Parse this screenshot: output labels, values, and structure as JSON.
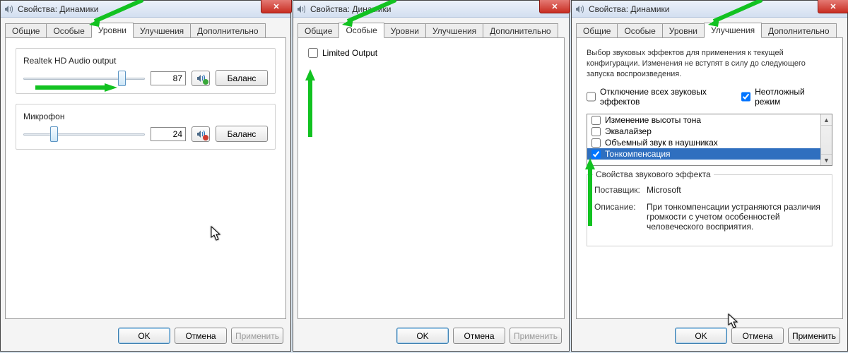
{
  "common": {
    "window_title": "Свойства: Динамики",
    "tabs": {
      "general": "Общие",
      "custom": "Особые",
      "levels": "Уровни",
      "enhance": "Улучшения",
      "advanced": "Дополнительно"
    },
    "btn": {
      "ok": "OK",
      "cancel": "Отмена",
      "apply": "Применить",
      "balance": "Баланс"
    }
  },
  "w1": {
    "dev1": {
      "label": "Realtek HD Audio output",
      "value": "87",
      "thumb_pct": 78
    },
    "dev2": {
      "label": "Микрофон",
      "value": "24",
      "thumb_pct": 22
    }
  },
  "w2": {
    "opt": "Limited Output"
  },
  "w3": {
    "desc": "Выбор звуковых эффектов для применения к текущей конфигурации. Изменения не вступят в силу до следующего запуска воспроизведения.",
    "disable_all": "Отключение всех звуковых эффектов",
    "urgent_mode": "Неотложный режим",
    "fx": [
      "Изменение высоты тона",
      "Эквалайзер",
      "Объемный звук в наушниках",
      "Тонкомпенсация"
    ],
    "props_legend": "Свойства звукового эффекта",
    "vendor_k": "Поставщик:",
    "vendor_v": "Microsoft",
    "desc_k": "Описание:",
    "desc_v": "При тонкомпенсации устраняются различия громкости с учетом особенностей человеческого восприятия."
  }
}
